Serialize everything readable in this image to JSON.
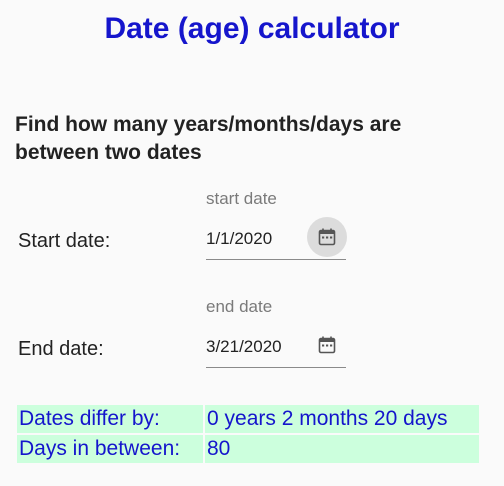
{
  "page": {
    "title": "Date (age) calculator",
    "subtitle": "Find how many years/months/days are between two dates"
  },
  "start": {
    "label": "Start date:",
    "caption": "start date",
    "value": "1/1/2020",
    "icon": "calendar-icon"
  },
  "end": {
    "label": "End date:",
    "caption": "end date",
    "value": "3/21/2020",
    "icon": "calendar-icon"
  },
  "result": {
    "differ_label": "Dates differ by:",
    "differ_value": "0 years 2 months 20 days",
    "days_label": "Days in between:",
    "days_value": "80"
  },
  "colors": {
    "title": "#1515cc",
    "result_bg": "#ccffdd",
    "result_text": "#1515cc"
  }
}
